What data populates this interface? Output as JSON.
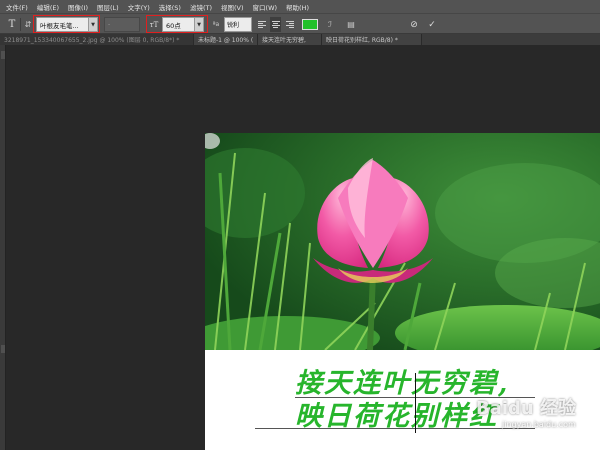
{
  "menu": [
    "文件(F)",
    "编辑(E)",
    "图像(I)",
    "图层(L)",
    "文字(Y)",
    "选择(S)",
    "滤镜(T)",
    "视图(V)",
    "窗口(W)",
    "帮助(H)"
  ],
  "options": {
    "font_family": "叶根友毛笔...",
    "font_style": "-",
    "font_size": "60点",
    "antialias": "锐利",
    "text_color": "#22c02a"
  },
  "tabs": [
    "3218971_153340067655_2.jpg @ 100% (图层 0, RGB/8*) *",
    "未标题-1 @ 100% (",
    "接天连叶无穷碧,",
    "映日荷花别样红, RGB/8) *"
  ],
  "canvas": {
    "text_line_1": "接天连叶无穷碧,",
    "text_line_2": "映日荷花别样红"
  },
  "watermark": {
    "logo": "Baidu 经验",
    "url": "jingyan.baidu.com"
  }
}
